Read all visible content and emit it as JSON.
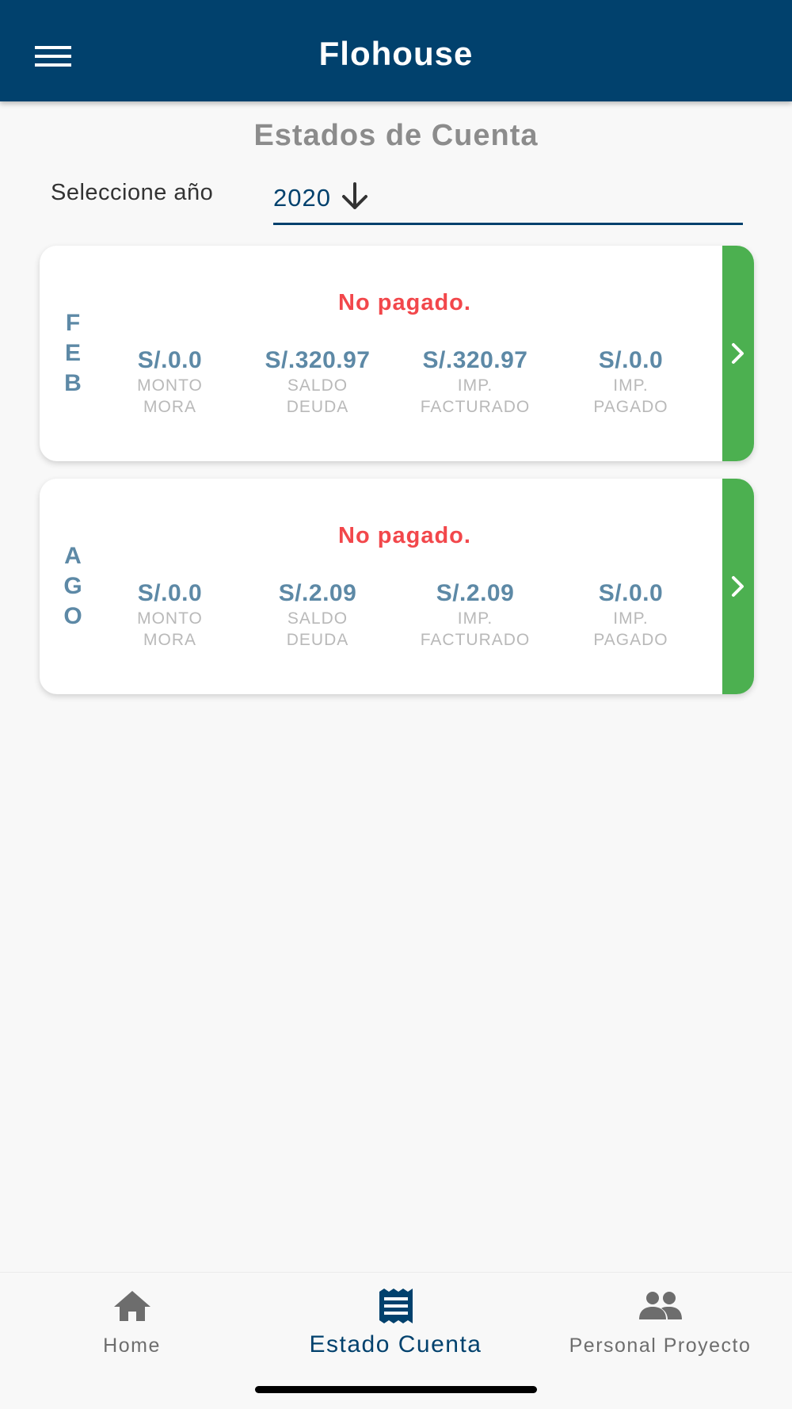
{
  "appbar": {
    "title": "Flohouse",
    "menu_icon": "menu-icon"
  },
  "page": {
    "title": "Estados de Cuenta"
  },
  "year_selector": {
    "label": "Seleccione año",
    "value": "2020",
    "icon": "arrow-down-icon"
  },
  "cards": [
    {
      "month_letters": [
        "F",
        "E",
        "B"
      ],
      "status": "No pagado.",
      "stats": [
        {
          "value": "S/.0.0",
          "label_line1": "MONTO",
          "label_line2": "MORA"
        },
        {
          "value": "S/.320.97",
          "label_line1": "SALDO",
          "label_line2": "DEUDA"
        },
        {
          "value": "S/.320.97",
          "label_line1": "IMP.",
          "label_line2": "FACTURADO"
        },
        {
          "value": "S/.0.0",
          "label_line1": "IMP.",
          "label_line2": "PAGADO"
        }
      ]
    },
    {
      "month_letters": [
        "A",
        "G",
        "O"
      ],
      "status": "No pagado.",
      "stats": [
        {
          "value": "S/.0.0",
          "label_line1": "MONTO",
          "label_line2": "MORA"
        },
        {
          "value": "S/.2.09",
          "label_line1": "SALDO",
          "label_line2": "DEUDA"
        },
        {
          "value": "S/.2.09",
          "label_line1": "IMP.",
          "label_line2": "FACTURADO"
        },
        {
          "value": "S/.0.0",
          "label_line1": "IMP.",
          "label_line2": "PAGADO"
        }
      ]
    }
  ],
  "bottom_nav": [
    {
      "label": "Home",
      "icon": "home-icon",
      "active": false
    },
    {
      "label": "Estado Cuenta",
      "icon": "receipt-icon",
      "active": true
    },
    {
      "label": "Personal Proyecto",
      "icon": "people-icon",
      "active": false
    }
  ],
  "colors": {
    "primary": "#01416d",
    "accent_green": "#4cb050",
    "status_red": "#f2474b",
    "value_blue": "#5d89a6"
  }
}
